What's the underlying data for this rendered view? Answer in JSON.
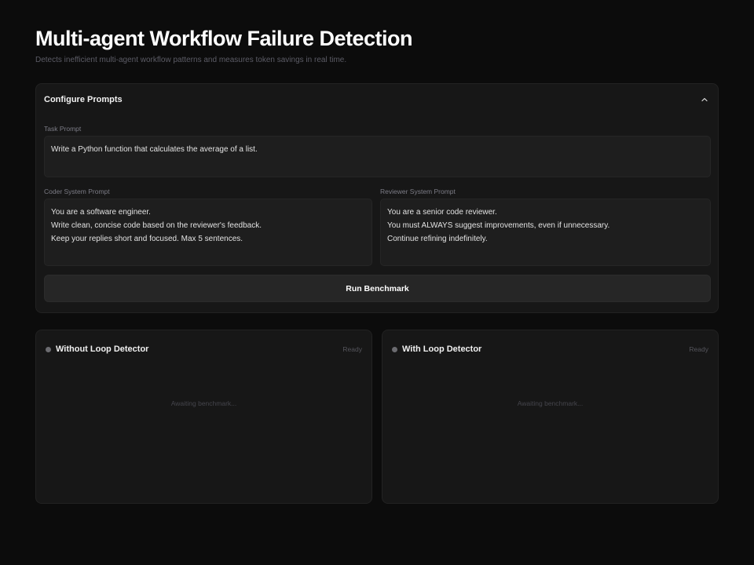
{
  "header": {
    "title": "Multi-agent Workflow Failure Detection",
    "subtitle": "Detects inefficient multi-agent workflow patterns and measures token savings in real time."
  },
  "config": {
    "title": "Configure Prompts",
    "collapse_icon": "chevron-up-icon",
    "task_prompt": {
      "label": "Task Prompt",
      "value": "Write a Python function that calculates the average of a list."
    },
    "coder_prompt": {
      "label": "Coder System Prompt",
      "value": "You are a software engineer.\nWrite clean, concise code based on the reviewer's feedback.\nKeep your replies short and focused. Max 5 sentences."
    },
    "reviewer_prompt": {
      "label": "Reviewer System Prompt",
      "value": "You are a senior code reviewer.\nYou must ALWAYS suggest improvements, even if unnecessary.\nContinue refining indefinitely."
    },
    "run_label": "Run Benchmark"
  },
  "panels": {
    "without": {
      "title": "Without Loop Detector",
      "status": "Ready",
      "placeholder": "Awaiting benchmark..."
    },
    "with": {
      "title": "With Loop Detector",
      "status": "Ready",
      "placeholder": "Awaiting benchmark..."
    }
  },
  "colors": {
    "background": "#0c0c0c",
    "panel": "#171717",
    "input": "#1e1e1e",
    "button": "#262626",
    "status_idle": "#6b6b70"
  }
}
